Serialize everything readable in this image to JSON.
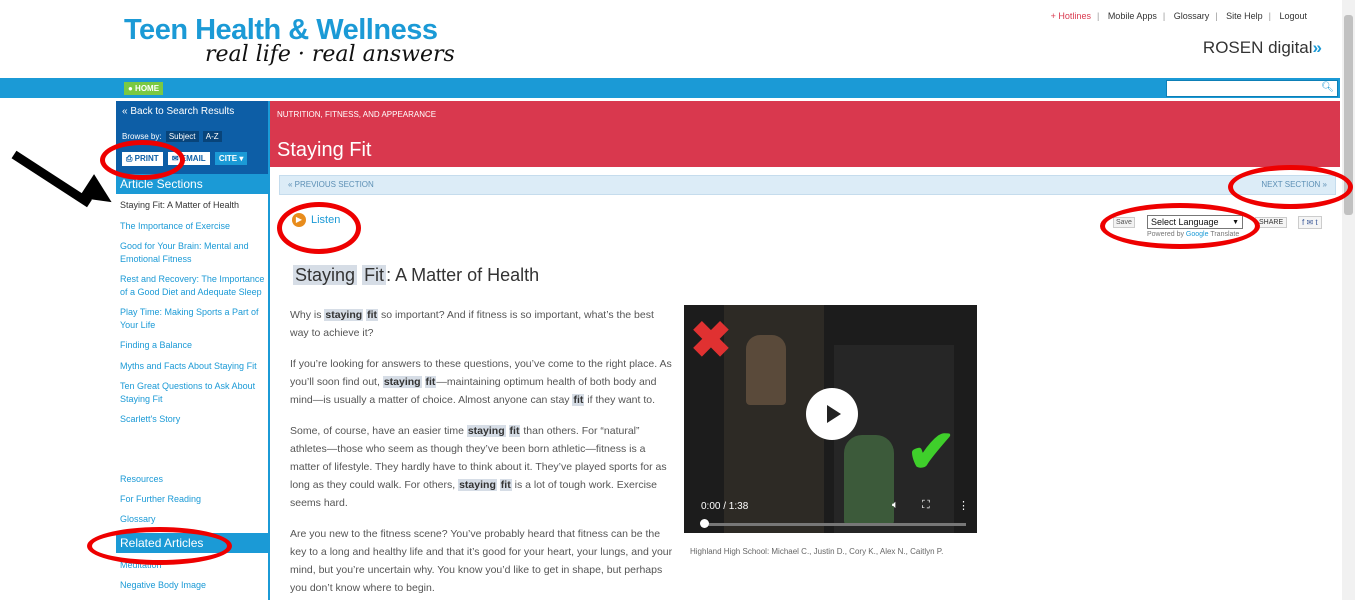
{
  "header": {
    "brand_title": "Teen Health & Wellness",
    "brand_tagline": "real life · real answers",
    "top_links": [
      "+ Hotlines",
      "Mobile Apps",
      "Glossary",
      "Site Help",
      "Logout"
    ],
    "publisher": "ROSEN digital",
    "publisher_mark": "»"
  },
  "nav": {
    "home_label": "● HOME",
    "search_placeholder": "",
    "search_icon": "magnifier"
  },
  "sidebar": {
    "back_label": "«  Back to Search Results",
    "browse_label": "Browse by:",
    "browse_subject": "Subject",
    "browse_az": "A-Z",
    "print_label": "PRINT",
    "email_label": "EMAIL",
    "cite_label": "CITE ▾",
    "sections_heading": "Article Sections",
    "sections": [
      "Staying Fit: A Matter of Health",
      "The Importance of Exercise",
      "Good for Your Brain: Mental and Emotional Fitness",
      "Rest and Recovery: The Importance of a Good Diet and Adequate Sleep",
      "Play Time: Making Sports a Part of Your Life",
      "Finding a Balance",
      "Myths and Facts About Staying Fit",
      "Ten Great Questions to Ask About Staying Fit",
      "Scarlett's Story"
    ],
    "resources": [
      "Resources",
      "For Further Reading",
      "Glossary"
    ],
    "related_heading": "Related Articles",
    "related": [
      "Meditation",
      "Negative Body Image"
    ]
  },
  "main": {
    "category": "NUTRITION, FITNESS, AND APPEARANCE",
    "page_title": "Staying Fit",
    "prev_section": "« PREVIOUS SECTION",
    "next_section": "NEXT SECTION »",
    "listen_label": "Listen",
    "save_label": "Save",
    "language_select": "Select Language",
    "powered_by": "Powered by",
    "google": "Google",
    "translate": "Translate",
    "share_label": "SHARE",
    "share_icons": "f ✉ t",
    "article_title_hl": "Staying",
    "article_title_hl2": "Fit",
    "article_title_rest": ": A Matter of Health",
    "video_time": "0:00 / 1:38",
    "video_caption": "Highland High School: Michael C., Justin D., Cory K., Alex N., Caitlyn P."
  },
  "colors": {
    "brand_blue": "#1b9ad6",
    "category_red": "#d9384e",
    "annotation_red": "#ee0000"
  }
}
